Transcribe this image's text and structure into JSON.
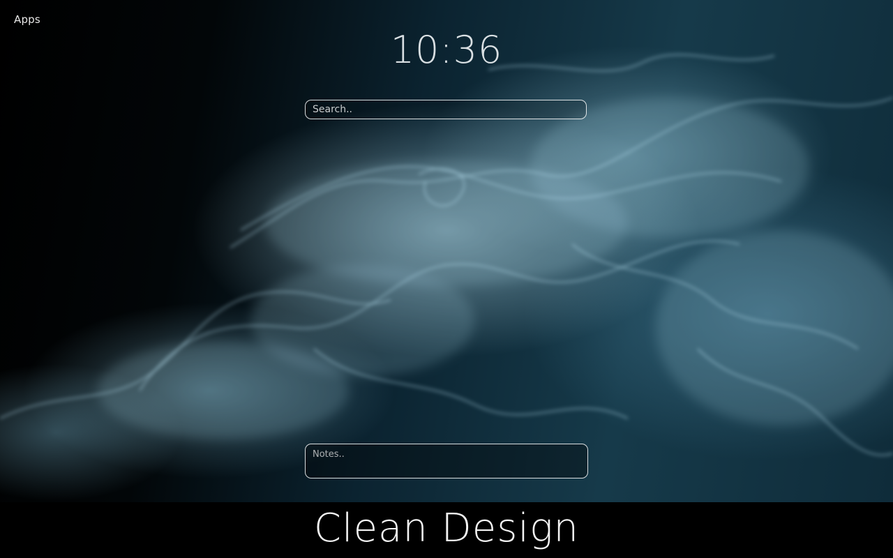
{
  "header": {
    "apps_label": "Apps"
  },
  "clock": {
    "time": "10:36"
  },
  "search": {
    "placeholder": "Search.."
  },
  "notes": {
    "placeholder": "Notes.."
  },
  "footer": {
    "caption": "Clean Design"
  },
  "colors": {
    "background": "#000000",
    "smoke_tint": "#8cc3d8",
    "text": "#f0f0f0"
  },
  "wallpaper": {
    "icon": "smoke-wallpaper"
  }
}
